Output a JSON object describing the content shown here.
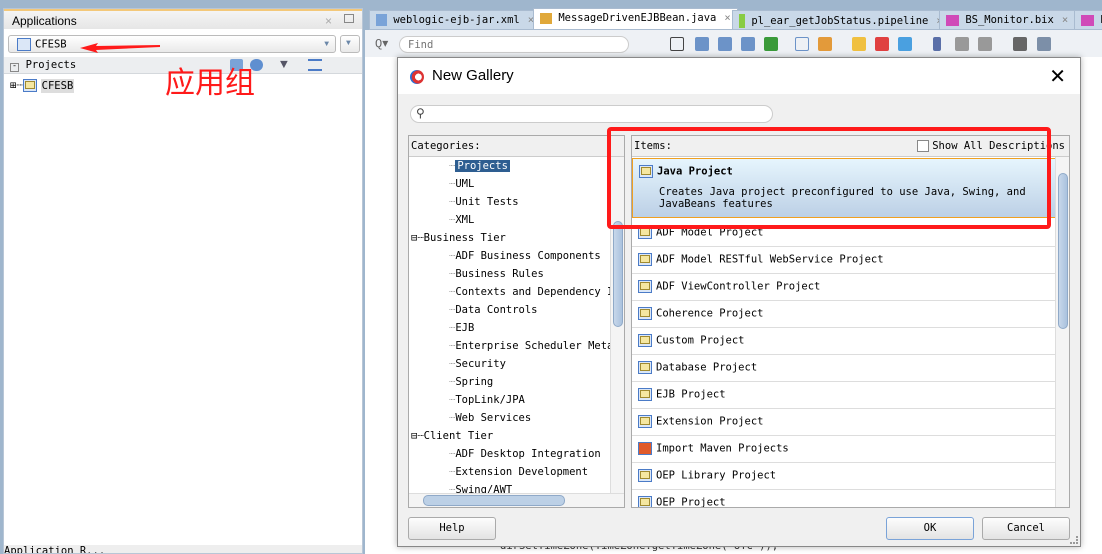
{
  "left_panel": {
    "title": "Applications",
    "app_selector": "CFESB",
    "projects_label": "Projects",
    "tree": [
      {
        "label": "CFESB"
      }
    ],
    "annotation": "应用组",
    "bottom_label": "Application R..."
  },
  "editor_tabs": [
    {
      "label": "weblogic-ejb-jar.xml"
    },
    {
      "label": "MessageDrivenEJBBean.java",
      "active": true
    },
    {
      "label": "pl_ear_getJobStatus.pipeline"
    },
    {
      "label": "BS_Monitor.bix"
    },
    {
      "label": "B"
    }
  ],
  "toolbar": {
    "find_placeholder": "Find"
  },
  "editor": {
    "code_line": "dirSetTimeZone(TimeZone.getTimeZone(\"UTC\"));"
  },
  "dialog": {
    "title": "New Gallery",
    "search_value": "",
    "categories_label": "Categories:",
    "categories": [
      {
        "label": "Projects",
        "level": 2,
        "selected": true
      },
      {
        "label": "UML",
        "level": 2
      },
      {
        "label": "Unit Tests",
        "level": 2
      },
      {
        "label": "XML",
        "level": 2
      },
      {
        "label": "Business Tier",
        "level": 1
      },
      {
        "label": "ADF Business Components",
        "level": 2
      },
      {
        "label": "Business Rules",
        "level": 2
      },
      {
        "label": "Contexts and Dependency Inj",
        "level": 2
      },
      {
        "label": "Data Controls",
        "level": 2
      },
      {
        "label": "EJB",
        "level": 2
      },
      {
        "label": "Enterprise Scheduler Metads",
        "level": 2
      },
      {
        "label": "Security",
        "level": 2
      },
      {
        "label": "Spring",
        "level": 2
      },
      {
        "label": "TopLink/JPA",
        "level": 2
      },
      {
        "label": "Web Services",
        "level": 2
      },
      {
        "label": "Client Tier",
        "level": 1
      },
      {
        "label": "ADF Desktop Integration",
        "level": 2
      },
      {
        "label": "Extension Development",
        "level": 2
      },
      {
        "label": "Swing/AWT",
        "level": 2
      }
    ],
    "items_label": "Items:",
    "show_all_descriptions": "Show All Descriptions",
    "show_all_checked": false,
    "items": [
      {
        "label": "Java Project",
        "description": "Creates Java project preconfigured to use Java, Swing, and JavaBeans features",
        "selected": true
      },
      {
        "label": "ADF Model Project"
      },
      {
        "label": "ADF Model RESTful WebService Project"
      },
      {
        "label": "ADF ViewController Project"
      },
      {
        "label": "Coherence Project"
      },
      {
        "label": "Custom Project"
      },
      {
        "label": "Database Project"
      },
      {
        "label": "EJB Project"
      },
      {
        "label": "Extension Project"
      },
      {
        "label": "Import Maven Projects",
        "icon": "maven-icon"
      },
      {
        "label": "OEP Library Project"
      },
      {
        "label": "OEP Project"
      }
    ],
    "buttons": {
      "help": "Help",
      "ok": "OK",
      "cancel": "Cancel"
    }
  },
  "colors": {
    "annotation": "#ff1a1a",
    "selection": "#2e5e91",
    "highlight_border": "#f0a020"
  }
}
